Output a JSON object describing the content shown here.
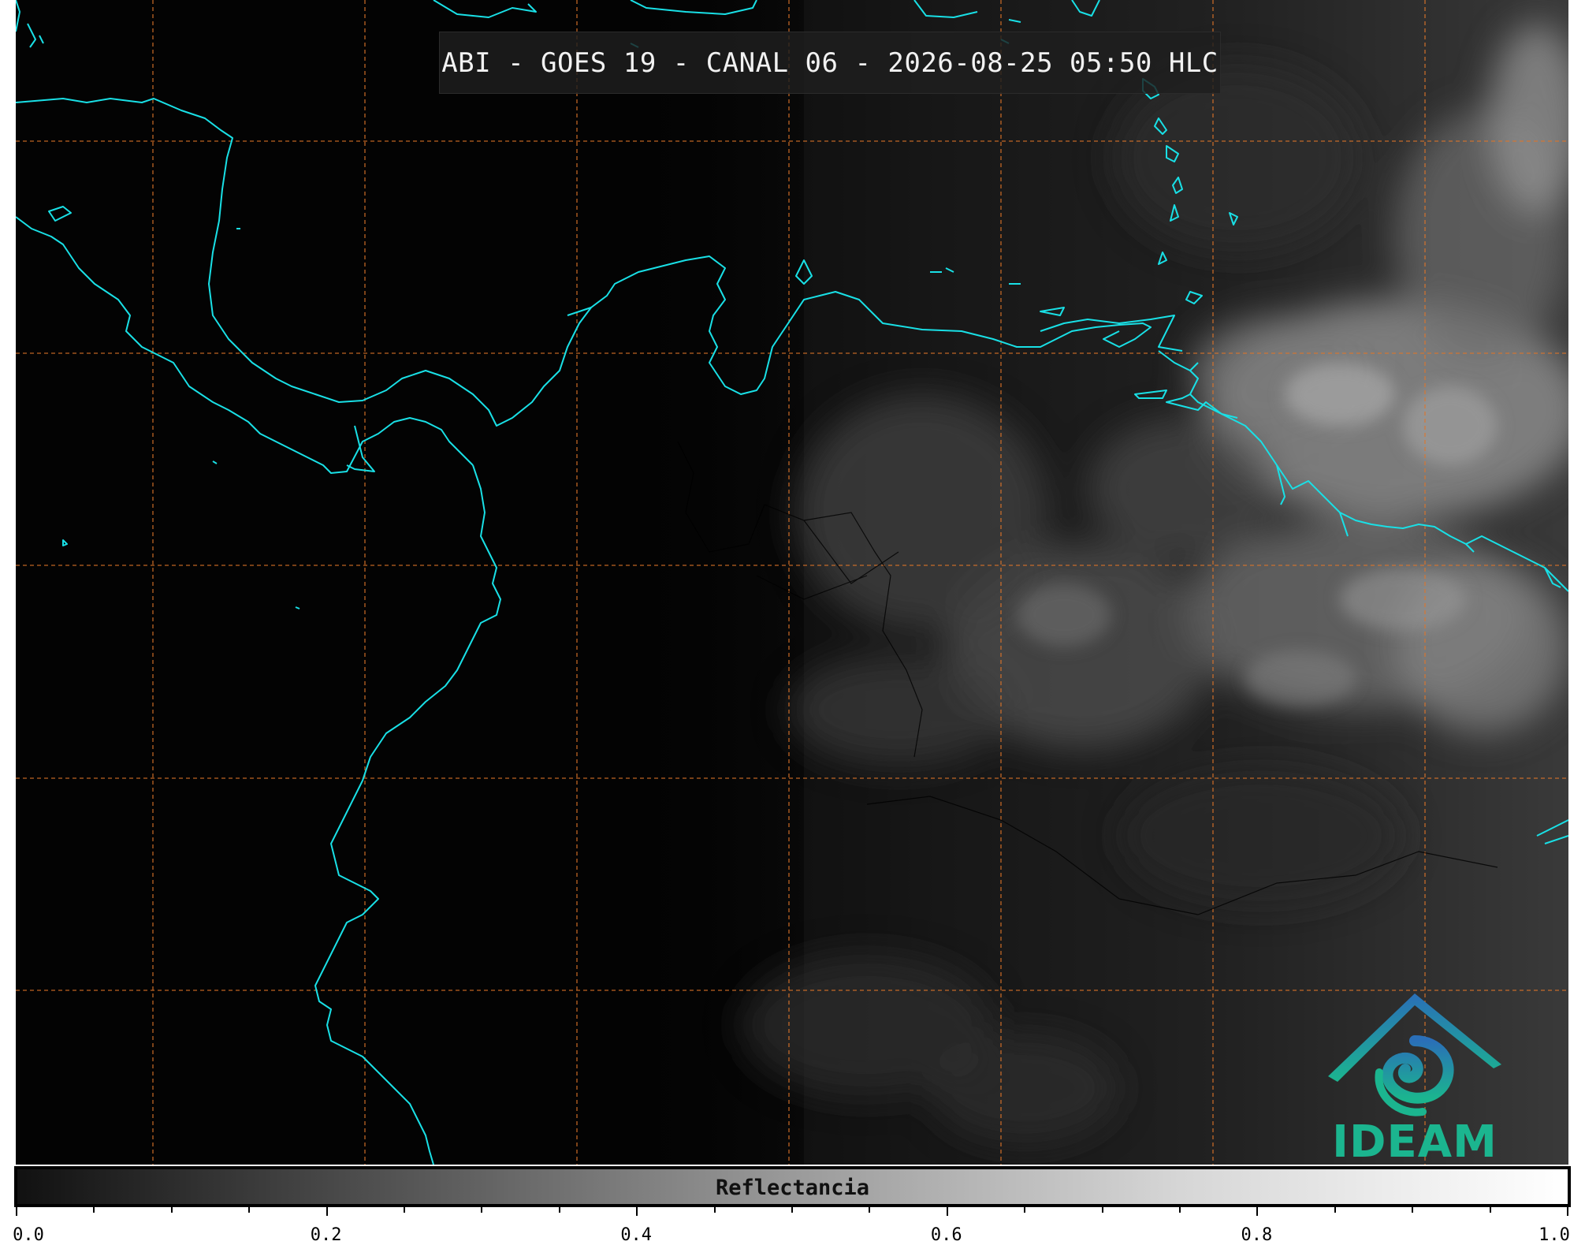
{
  "title": "ABI - GOES 19 - CANAL 06 - 2026-08-25 05:50 HLC",
  "colors": {
    "coastline": "#19e0e6",
    "gridlines": "#e0762a",
    "background": "#030303",
    "logo_blue": "#2a6fb8",
    "logo_green": "#1bb58f"
  },
  "logo": {
    "text": "IDEAM"
  },
  "colorbar": {
    "label": "Reflectancia",
    "range": [
      0.0,
      1.0
    ],
    "ticks": [
      "0.0",
      "0.2",
      "0.4",
      "0.6",
      "0.8",
      "1.0"
    ],
    "colormap": "grayscale"
  }
}
